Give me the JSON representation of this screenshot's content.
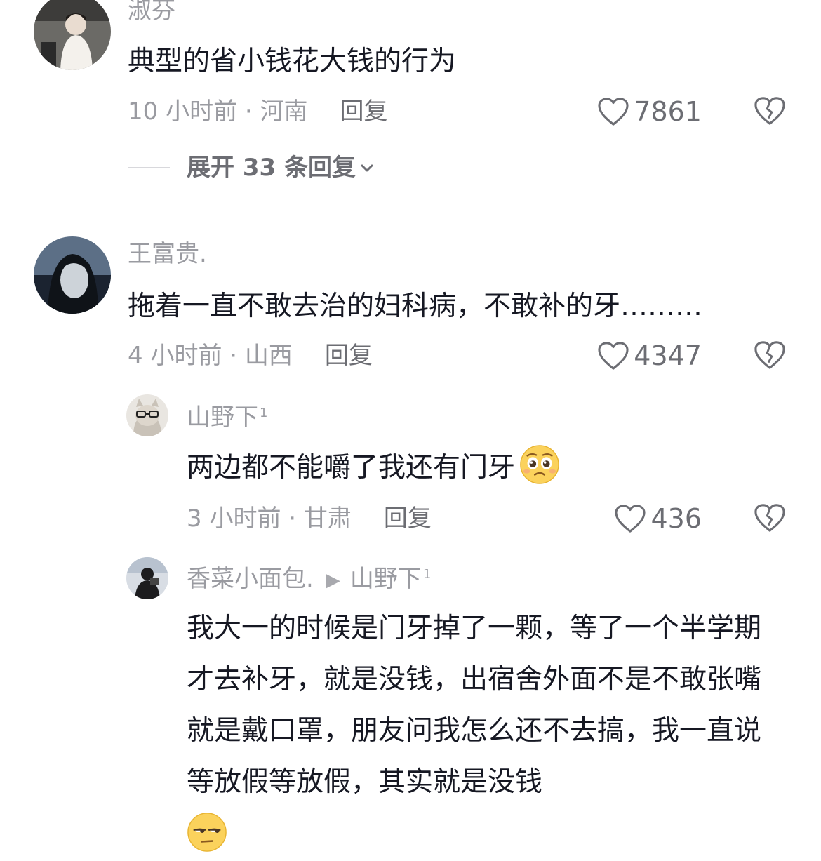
{
  "colors": {
    "meta": "#9a9ba1",
    "text": "#161823",
    "action": "#6c6d73"
  },
  "comments": [
    {
      "username": "淑芬",
      "text": "典型的省小钱花大钱的行为",
      "time_location": "10 小时前 · 河南",
      "reply_label": "回复",
      "likes": "7861",
      "expand_label": "展开 33 条回复"
    },
    {
      "username": "王富贵.",
      "text": "拖着一直不敢去治的妇科病，不敢补的牙………",
      "time_location": "4 小时前 · 山西",
      "reply_label": "回复",
      "likes": "4347"
    }
  ],
  "replies": [
    {
      "username": "山野下",
      "badge": "1",
      "text": "两边都不能嚼了我还有门牙",
      "emoji": "pleading-face",
      "time_location": "3 小时前 · 甘肃",
      "reply_label": "回复",
      "likes": "436"
    },
    {
      "username": "香菜小面包.",
      "reply_to": "山野下",
      "reply_to_badge": "1",
      "text": "我大一的时候是门牙掉了一颗，等了一个半学期才去补牙，就是没钱，出宿舍外面不是不敢张嘴就是戴口罩，朋友问我怎么还不去搞，我一直说等放假等放假，其实就是没钱",
      "emoji": "unamused-face"
    }
  ]
}
